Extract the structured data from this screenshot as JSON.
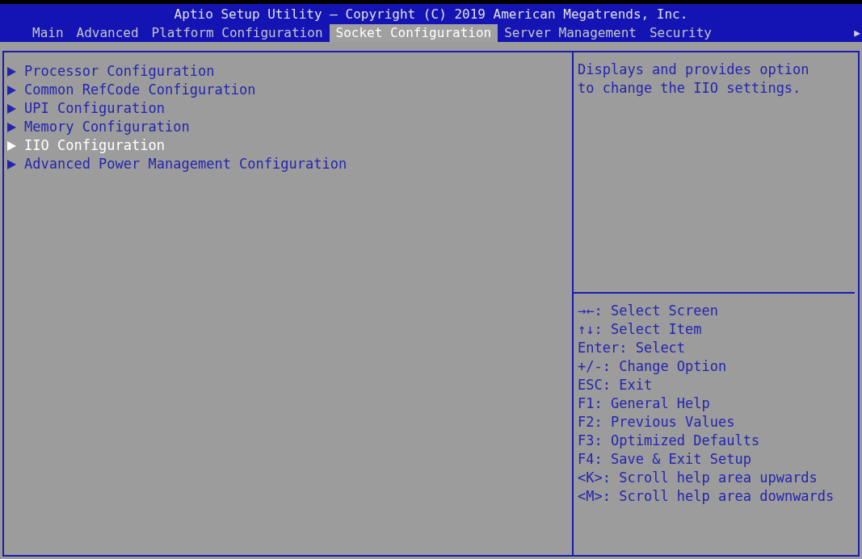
{
  "header": {
    "title": "Aptio Setup Utility – Copyright (C) 2019 American Megatrends, Inc.",
    "more_tabs": "▶"
  },
  "tabs": [
    {
      "label": "Main",
      "selected": false
    },
    {
      "label": "Advanced",
      "selected": false
    },
    {
      "label": "Platform Configuration",
      "selected": false
    },
    {
      "label": "Socket Configuration",
      "selected": true
    },
    {
      "label": "Server Management",
      "selected": false
    },
    {
      "label": "Security",
      "selected": false
    }
  ],
  "menu": [
    {
      "label": "Processor Configuration",
      "selected": false
    },
    {
      "label": "Common RefCode Configuration",
      "selected": false
    },
    {
      "label": "UPI Configuration",
      "selected": false
    },
    {
      "label": "Memory Configuration",
      "selected": false
    },
    {
      "label": "IIO Configuration",
      "selected": true
    },
    {
      "label": "Advanced Power Management Configuration",
      "selected": false
    }
  ],
  "help": {
    "description": "Displays and provides option to change the IIO settings.",
    "keys": [
      {
        "key": "→←:",
        "action": "Select Screen"
      },
      {
        "key": "↑↓:",
        "action": "Select Item"
      },
      {
        "key": "Enter:",
        "action": "Select"
      },
      {
        "key": "+/-:",
        "action": "Change Option"
      },
      {
        "key": "ESC:",
        "action": "Exit"
      },
      {
        "key": "F1:",
        "action": "General Help"
      },
      {
        "key": "F2:",
        "action": "Previous Values"
      },
      {
        "key": "F3:",
        "action": "Optimized Defaults"
      },
      {
        "key": "F4:",
        "action": "Save & Exit Setup"
      },
      {
        "key": "<K>:",
        "action": "Scroll help area upwards"
      },
      {
        "key": "<M>:",
        "action": "Scroll help area downwards"
      }
    ]
  }
}
